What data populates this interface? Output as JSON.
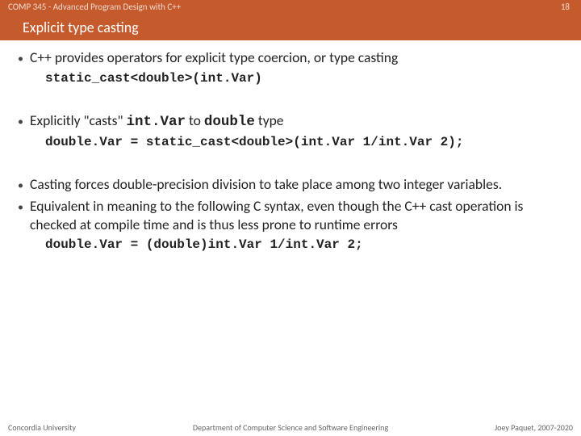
{
  "header": {
    "course": "COMP 345 - Advanced Program Design with C++",
    "slide_number": "18",
    "title": "Explicit type casting"
  },
  "content": {
    "bullets": [
      {
        "text": "C++ provides operators for explicit type coercion, or type casting",
        "code": "static_cast<double>(int.Var)"
      },
      {
        "html_parts": {
          "t1": "Explicitly \"casts\" ",
          "c1": "int.Var",
          "t2": " to ",
          "c2": "double",
          "t3": " type"
        },
        "code": "double.Var = static_cast<double>(int.Var 1/int.Var 2);"
      },
      {
        "text": "Casting forces double-precision division to take place among two integer variables."
      },
      {
        "text": "Equivalent in meaning to the following C syntax, even though the C++ cast operation is checked at compile time and is thus less prone to runtime errors",
        "code": "double.Var = (double)int.Var 1/int.Var 2;"
      }
    ]
  },
  "footer": {
    "left": "Concordia University",
    "center": "Department of Computer Science and Software Engineering",
    "right": "Joey Paquet, 2007-2020"
  }
}
